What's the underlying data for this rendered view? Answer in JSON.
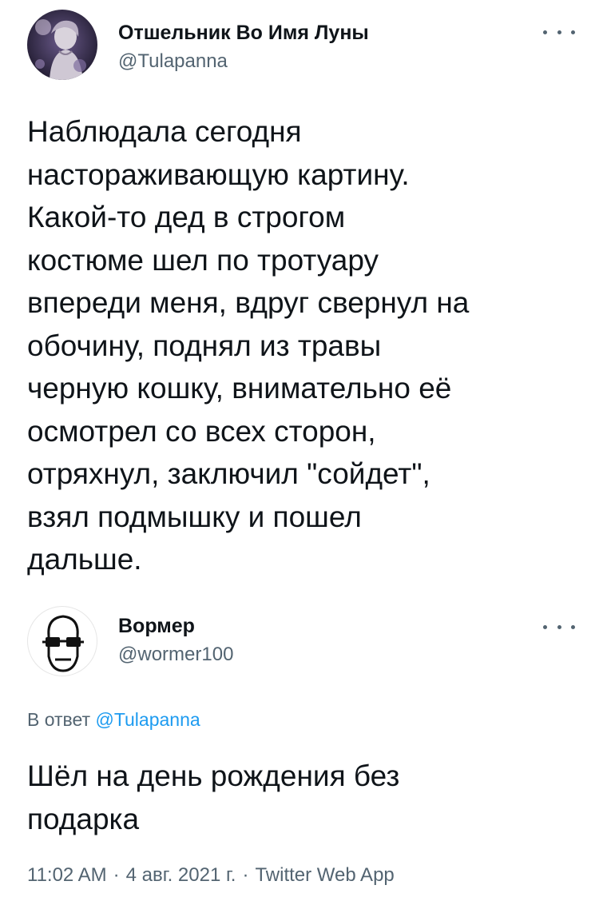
{
  "main_tweet": {
    "display_name": "Отшельник Во Имя Луны",
    "handle": "@Tulapanna",
    "avatar_icon": "statue-avatar-icon",
    "more_icon": "more-options-icon",
    "text": "Наблюдала сегодня\nнастораживающую картину.\nКакой-то дед в строгом\nкостюме шел по тротуару\nвпереди меня, вдруг свернул на\nобочину, поднял из травы\nчерную кошку, внимательно её\nосмотрел со всех сторон,\nотряхнул, заключил \"сойдет\",\nвзял подмышку и пошел\nдальше."
  },
  "reply_tweet": {
    "display_name": "Вормер",
    "handle": "@wormer100",
    "avatar_icon": "sketch-face-avatar-icon",
    "more_icon": "more-options-icon",
    "reply_to_prefix": "В ответ",
    "reply_to_handle": "@Tulapanna",
    "text": "Шёл на день рождения без\nподарка",
    "time": "11:02 AM",
    "date": "4 авг. 2021 г.",
    "separator": "·",
    "source": "Twitter Web App"
  },
  "colors": {
    "text": "#0f1419",
    "secondary": "#536471",
    "link": "#1d9bf0"
  }
}
